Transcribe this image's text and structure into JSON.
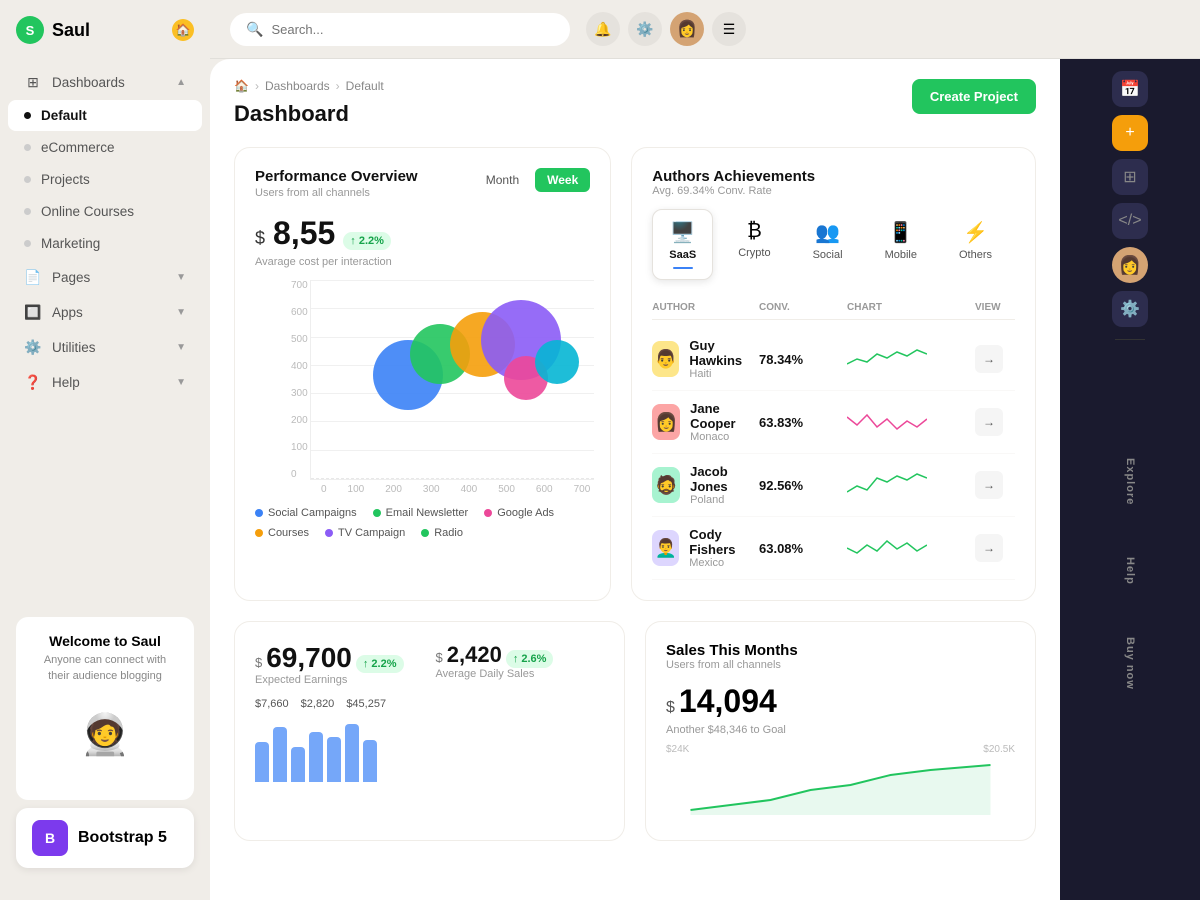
{
  "app": {
    "name": "Saul",
    "logo_letter": "S"
  },
  "sidebar": {
    "items": [
      {
        "id": "dashboards",
        "label": "Dashboards",
        "type": "icon",
        "icon": "⊞",
        "has_chevron": true,
        "active": false
      },
      {
        "id": "default",
        "label": "Default",
        "type": "dot",
        "active": true
      },
      {
        "id": "ecommerce",
        "label": "eCommerce",
        "type": "dot",
        "active": false
      },
      {
        "id": "projects",
        "label": "Projects",
        "type": "dot",
        "active": false
      },
      {
        "id": "online-courses",
        "label": "Online Courses",
        "type": "dot",
        "active": false
      },
      {
        "id": "marketing",
        "label": "Marketing",
        "type": "dot",
        "active": false
      },
      {
        "id": "pages",
        "label": "Pages",
        "type": "icon",
        "icon": "📄",
        "has_chevron": true,
        "active": false
      },
      {
        "id": "apps",
        "label": "Apps",
        "type": "icon",
        "icon": "🔲",
        "has_chevron": true,
        "active": false
      },
      {
        "id": "utilities",
        "label": "Utilities",
        "type": "icon",
        "icon": "⚙️",
        "has_chevron": true,
        "active": false
      },
      {
        "id": "help",
        "label": "Help",
        "type": "icon",
        "icon": "❓",
        "has_chevron": true,
        "active": false
      }
    ],
    "welcome": {
      "title": "Welcome to Saul",
      "subtitle": "Anyone can connect with their audience blogging"
    },
    "bootstrap": {
      "label": "Bootstrap 5",
      "letter": "B"
    }
  },
  "header": {
    "search_placeholder": "Search...",
    "create_button": "Create Project"
  },
  "breadcrumb": {
    "home": "🏠",
    "dashboards": "Dashboards",
    "default": "Default",
    "page_title": "Dashboard"
  },
  "performance": {
    "title": "Performance Overview",
    "subtitle": "Users from all channels",
    "tabs": [
      "Month",
      "Week"
    ],
    "active_tab": "Week",
    "price": "8,55",
    "dollar_sign": "$",
    "badge": "↑ 2.2%",
    "price_label": "Avarage cost per interaction",
    "y_labels": [
      "700",
      "600",
      "500",
      "400",
      "300",
      "200",
      "100",
      "0"
    ],
    "x_labels": [
      "0",
      "100",
      "200",
      "300",
      "400",
      "500",
      "600",
      "700"
    ],
    "bubbles": [
      {
        "x": 28,
        "y": 38,
        "size": 70,
        "color": "#3b82f6"
      },
      {
        "x": 38,
        "y": 32,
        "size": 58,
        "color": "#22c55e"
      },
      {
        "x": 50,
        "y": 26,
        "size": 60,
        "color": "#f59e0b"
      },
      {
        "x": 60,
        "y": 20,
        "size": 80,
        "color": "#8b5cf6"
      },
      {
        "x": 68,
        "y": 38,
        "size": 44,
        "color": "#ec4899"
      },
      {
        "x": 79,
        "y": 34,
        "size": 44,
        "color": "#06b6d4"
      }
    ],
    "legend": [
      {
        "label": "Social Campaigns",
        "color": "#3b82f6"
      },
      {
        "label": "Email Newsletter",
        "color": "#22c55e"
      },
      {
        "label": "Google Ads",
        "color": "#ec4899"
      },
      {
        "label": "Courses",
        "color": "#f59e0b"
      },
      {
        "label": "TV Campaign",
        "color": "#8b5cf6"
      },
      {
        "label": "Radio",
        "color": "#22c55e"
      }
    ]
  },
  "authors": {
    "title": "Authors Achievements",
    "subtitle": "Avg. 69.34% Conv. Rate",
    "categories": [
      {
        "id": "saas",
        "label": "SaaS",
        "icon": "🖥️",
        "active": true
      },
      {
        "id": "crypto",
        "label": "Crypto",
        "icon": "₿",
        "active": false
      },
      {
        "id": "social",
        "label": "Social",
        "icon": "👥",
        "active": false
      },
      {
        "id": "mobile",
        "label": "Mobile",
        "icon": "📱",
        "active": false
      },
      {
        "id": "others",
        "label": "Others",
        "icon": "⚡",
        "active": false
      }
    ],
    "table_headers": [
      "AUTHOR",
      "CONV.",
      "CHART",
      "VIEW"
    ],
    "rows": [
      {
        "name": "Guy Hawkins",
        "country": "Haiti",
        "conv": "78.34%",
        "chart_color": "#22c55e",
        "avatar": "👨"
      },
      {
        "name": "Jane Cooper",
        "country": "Monaco",
        "conv": "63.83%",
        "chart_color": "#ec4899",
        "avatar": "👩"
      },
      {
        "name": "Jacob Jones",
        "country": "Poland",
        "conv": "92.56%",
        "chart_color": "#22c55e",
        "avatar": "🧔"
      },
      {
        "name": "Cody Fishers",
        "country": "Mexico",
        "conv": "63.08%",
        "chart_color": "#22c55e",
        "avatar": "👨‍🦱"
      }
    ]
  },
  "earnings": {
    "expected_label": "Expected Earnings",
    "expected_value": "69,700",
    "expected_badge": "↑ 2.2%",
    "daily_label": "Average Daily Sales",
    "daily_dollar": "$",
    "daily_value": "2,420",
    "daily_badge": "↑ 2.6%",
    "dollar_sign": "$",
    "rows": [
      {
        "label": "$7,660"
      },
      {
        "label": "$2,820"
      },
      {
        "label": "$45,257"
      }
    ]
  },
  "sales": {
    "title": "Sales This Months",
    "subtitle": "Users from all channels",
    "dollar": "$",
    "amount": "14,094",
    "note": "Another $48,346 to Goal",
    "axis_labels": [
      "$24K",
      "$20.5K"
    ]
  },
  "right_panel": {
    "icons": [
      "📅",
      "+",
      "⊞",
      "</>",
      "👤",
      "⚙️"
    ],
    "labels": [
      "Explore",
      "Help",
      "Buy now"
    ]
  }
}
